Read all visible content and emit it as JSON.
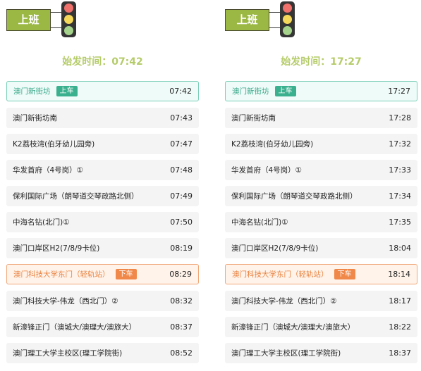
{
  "schedules": [
    {
      "sign_label": "上班",
      "departure_text": "始发时间：07:42",
      "stops": [
        {
          "name": "澳门新街坊",
          "time": "07:42"
        },
        {
          "name": "澳门新街坊南",
          "time": "07:43"
        },
        {
          "name": "K2荔枝湾(伯牙幼儿园旁)",
          "time": "07:47"
        },
        {
          "name": "华发首府（4号岗）①",
          "time": "07:48"
        },
        {
          "name": "保利国际广场（朗琴道交琴政路北侧）",
          "time": "07:49"
        },
        {
          "name": "中海名钻(北门)①",
          "time": "07:50"
        },
        {
          "name": "澳门口岸区H2(7/8/9卡位)",
          "time": "08:19"
        },
        {
          "name": "澳门科技大学东门（轻轨站）",
          "time": "08:29"
        },
        {
          "name": "澳门科技大学-伟龙（西北门）②",
          "time": "08:32"
        },
        {
          "name": "新濠锋正门（澳城大/澳理大/澳旅大）",
          "time": "08:37"
        },
        {
          "name": "澳门理工大学主校区(理工学院街)",
          "time": "08:52"
        }
      ]
    },
    {
      "sign_label": "上班",
      "departure_text": "始发时间：17:27",
      "stops": [
        {
          "name": "澳门新街坊",
          "time": "17:27"
        },
        {
          "name": "澳门新街坊南",
          "time": "17:28"
        },
        {
          "name": "K2荔枝湾(伯牙幼儿园旁)",
          "time": "17:32"
        },
        {
          "name": "华发首府（4号岗）①",
          "time": "17:33"
        },
        {
          "name": "保利国际广场（朗琴道交琴政路北侧）",
          "time": "17:34"
        },
        {
          "name": "中海名钻(北门)①",
          "time": "17:35"
        },
        {
          "name": "澳门口岸区H2(7/8/9卡位)",
          "time": "18:04"
        },
        {
          "name": "澳门科技大学东门（轻轨站）",
          "time": "18:14"
        },
        {
          "name": "澳门科技大学-伟龙（西北门）②",
          "time": "18:17"
        },
        {
          "name": "新濠锋正门（澳城大/澳理大/澳旅大）",
          "time": "18:22"
        },
        {
          "name": "澳门理工大学主校区(理工学院街)",
          "time": "18:37"
        }
      ]
    }
  ],
  "badges": {
    "board": "上车",
    "alight": "下车"
  },
  "colors": {
    "sign_bg": "#9bb844",
    "departure_text": "#b5cc6a",
    "board_accent": "#3bb08f",
    "alight_accent": "#f0884a",
    "row_bg": "#f4f4f4"
  }
}
